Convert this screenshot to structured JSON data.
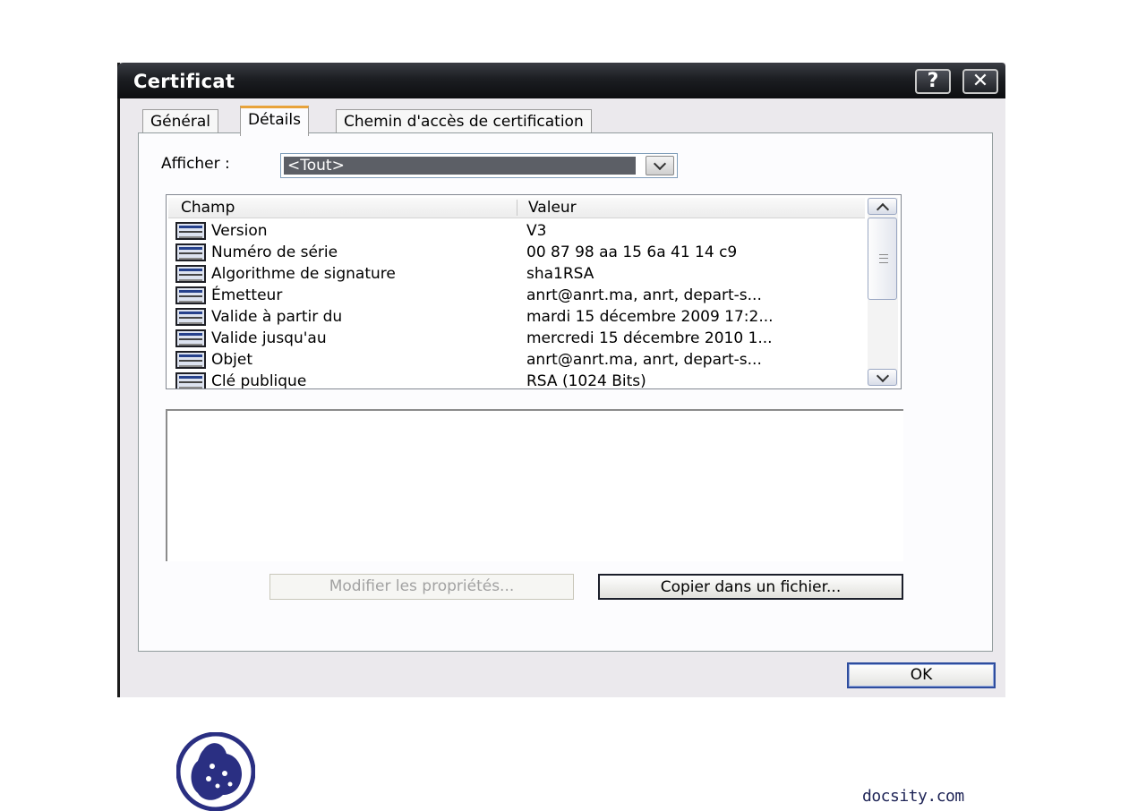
{
  "window": {
    "title": "Certificat",
    "help_glyph": "?",
    "close_glyph": "✕"
  },
  "tabs": [
    {
      "label": "Général",
      "active": false
    },
    {
      "label": "Détails",
      "active": true
    },
    {
      "label": "Chemin d'accès de certification",
      "active": false
    }
  ],
  "show": {
    "label": "Afficher :",
    "value": "<Tout>"
  },
  "list": {
    "columns": [
      "Champ",
      "Valeur"
    ],
    "rows": [
      {
        "field": "Version",
        "value": "V3"
      },
      {
        "field": "Numéro de série",
        "value": "00 87 98 aa 15 6a 41 14 c9"
      },
      {
        "field": "Algorithme de signature",
        "value": "sha1RSA"
      },
      {
        "field": "Émetteur",
        "value": "anrt@anrt.ma, anrt, depart-s..."
      },
      {
        "field": "Valide à partir du",
        "value": "mardi 15 décembre 2009 17:2..."
      },
      {
        "field": "Valide jusqu'au",
        "value": "mercredi 15 décembre 2010 1..."
      },
      {
        "field": "Objet",
        "value": "anrt@anrt.ma, anrt, depart-s..."
      },
      {
        "field": "Clé publique",
        "value": "RSA (1024 Bits)"
      }
    ]
  },
  "buttons": {
    "edit_properties": "Modifier les propriétés...",
    "copy_to_file": "Copier dans un fichier...",
    "ok": "OK"
  },
  "footer": {
    "brand": "docsity.com"
  },
  "colors": {
    "titlebar": "#1c1e22",
    "selection": "#5c5f66",
    "logo": "#2a2f82"
  }
}
